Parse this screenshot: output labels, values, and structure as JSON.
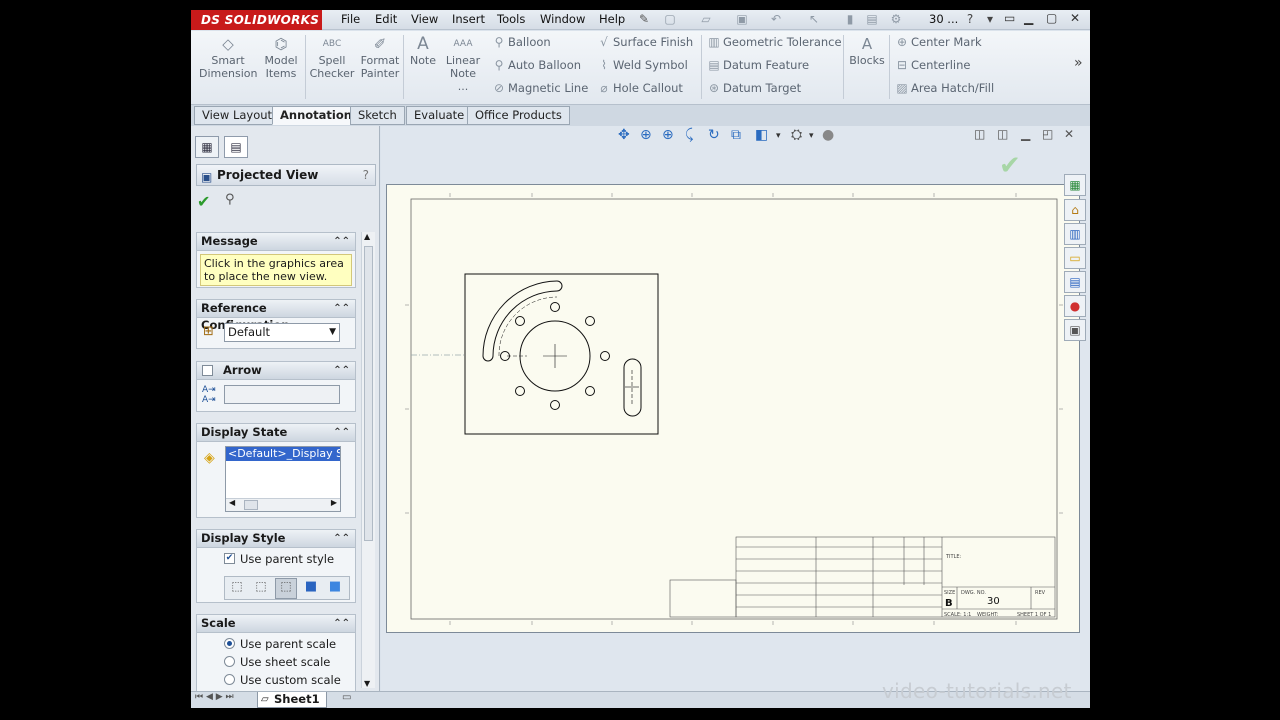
{
  "app": {
    "logo": "DS SOLIDWORKS",
    "menu": [
      "File",
      "Edit",
      "View",
      "Insert",
      "Tools",
      "Window",
      "Help"
    ],
    "search_text": "30 ..."
  },
  "ribbon": {
    "big": [
      {
        "label": "Smart Dimension",
        "icon": "smart-dimension-icon"
      },
      {
        "label": "Model Items",
        "icon": "model-items-icon"
      },
      {
        "label": "Spell Checker",
        "icon": "spell-checker-icon"
      },
      {
        "label": "Format Painter",
        "icon": "format-painter-icon"
      },
      {
        "label": "Note",
        "icon": "note-icon"
      },
      {
        "label": "Linear Note ...",
        "icon": "linear-note-icon"
      },
      {
        "label": "Blocks",
        "icon": "blocks-icon"
      }
    ],
    "col1": [
      "Balloon",
      "Auto Balloon",
      "Magnetic Line"
    ],
    "col2": [
      "Surface Finish",
      "Weld Symbol",
      "Hole Callout"
    ],
    "col3": [
      "Geometric Tolerance",
      "Datum Feature",
      "Datum Target"
    ],
    "col4": [
      "Center Mark",
      "Centerline",
      "Area Hatch/Fill"
    ]
  },
  "tabs": [
    "View Layout",
    "Annotation",
    "Sketch",
    "Evaluate",
    "Office Products"
  ],
  "active_tab": "Annotation",
  "property_manager": {
    "title": "Projected View",
    "help": "?",
    "message": {
      "header": "Message",
      "text": "Click in the graphics area to place the new view."
    },
    "reference_configuration": {
      "header": "Reference Configuration",
      "value": "Default"
    },
    "arrow": {
      "header": "Arrow",
      "checked": false,
      "value": ""
    },
    "display_state": {
      "header": "Display State",
      "item": "<Default>_Display St"
    },
    "display_style": {
      "header": "Display Style",
      "use_parent_style": "Use parent style",
      "checked": true
    },
    "scale": {
      "header": "Scale",
      "options": [
        "Use parent scale",
        "Use sheet scale",
        "Use custom scale"
      ],
      "selected": 0
    }
  },
  "sheet_tab": "Sheet1",
  "title_block": {
    "size": "B",
    "dwg_no_label": "DWG. NO.",
    "dwg_no": "30",
    "rev_label": "REV",
    "scale_label": "SCALE: 1:1",
    "weight_label": "WEIGHT:",
    "sheet_label": "SHEET 1 OF 1",
    "title_label": "TITLE:"
  },
  "watermark": "video-tutorials.net",
  "colors": {
    "logo_red": "#c81a1a",
    "ok_green": "#2c9a2c",
    "sheet_bg": "#fbfbf0",
    "message_yellow": "#ffffc0"
  }
}
